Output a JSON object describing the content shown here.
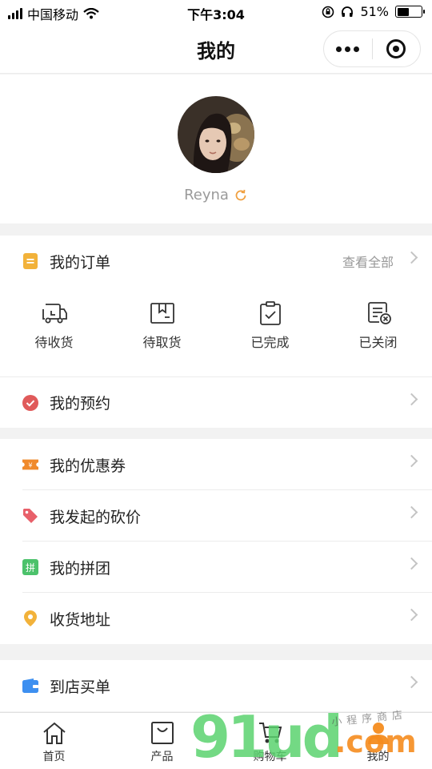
{
  "status_bar": {
    "carrier": "中国移动",
    "time": "下午3:04",
    "battery_percent": "51%",
    "battery_level": 0.51
  },
  "navbar": {
    "title": "我的"
  },
  "profile": {
    "username": "Reyna"
  },
  "orders": {
    "title": "我的订单",
    "view_all": "查看全部",
    "statuses": [
      {
        "label": "待收货",
        "icon": "truck-icon"
      },
      {
        "label": "待取货",
        "icon": "package-icon"
      },
      {
        "label": "已完成",
        "icon": "clipboard-check-icon"
      },
      {
        "label": "已关闭",
        "icon": "list-closed-icon"
      }
    ]
  },
  "menu": {
    "appointments": "我的预约",
    "coupons": "我的优惠券",
    "bargains": "我发起的砍价",
    "group_buy": "我的拼团",
    "address": "收货地址",
    "store_pay": "到店买单"
  },
  "tabs": [
    {
      "label": "首页",
      "icon": "home-icon"
    },
    {
      "label": "产品",
      "icon": "shopping-bag-icon"
    },
    {
      "label": "购物车",
      "icon": "cart-icon"
    },
    {
      "label": "我的",
      "icon": "user-icon"
    }
  ],
  "watermark": {
    "big": "91ud",
    "com": ".com",
    "small": "小程序商店"
  },
  "colors": {
    "order_icon": "#f2b23a",
    "appointment_icon": "#e05a5a",
    "coupon_icon": "#f08a2c",
    "bargain_icon": "#e8606a",
    "group_icon": "#4cc26b",
    "address_icon": "#f2b23a",
    "store_icon": "#3d8ff0"
  }
}
